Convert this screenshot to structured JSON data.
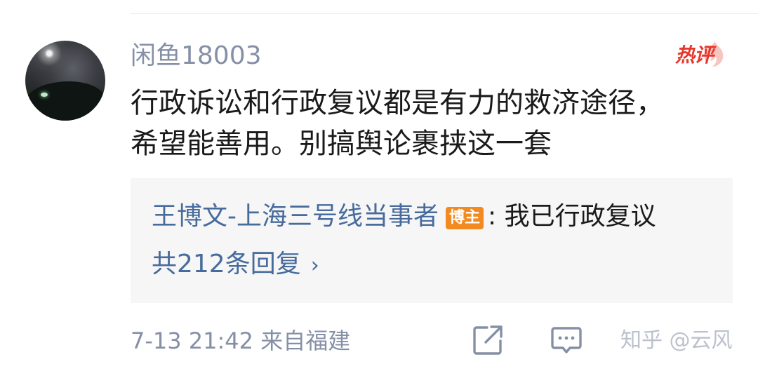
{
  "comment": {
    "username": "闲鱼18003",
    "hot_label": "热评",
    "text_line1": "行政诉讼和行政复议都是有力的救济途径，",
    "text_line2": "希望能善用。别搞舆论裹挟这一套",
    "time_location": "7-13 21:42 来自福建"
  },
  "reply_preview": {
    "author": "王博文-上海三号线当事者",
    "badge": "博主",
    "colon": ":",
    "text": "我已行政复议",
    "count_label": "共212条回复",
    "chevron": "›"
  },
  "watermark": "知乎 @云风",
  "icons": [
    "share-icon",
    "comment-icon",
    "flame-icon",
    "chevron-right-icon"
  ],
  "colors": {
    "meta_gray": "#8590a6",
    "link_blue": "#476b9c",
    "hot_red": "#e8372c",
    "badge_orange": "#f28a22",
    "reply_bg": "#f6f6f6"
  }
}
